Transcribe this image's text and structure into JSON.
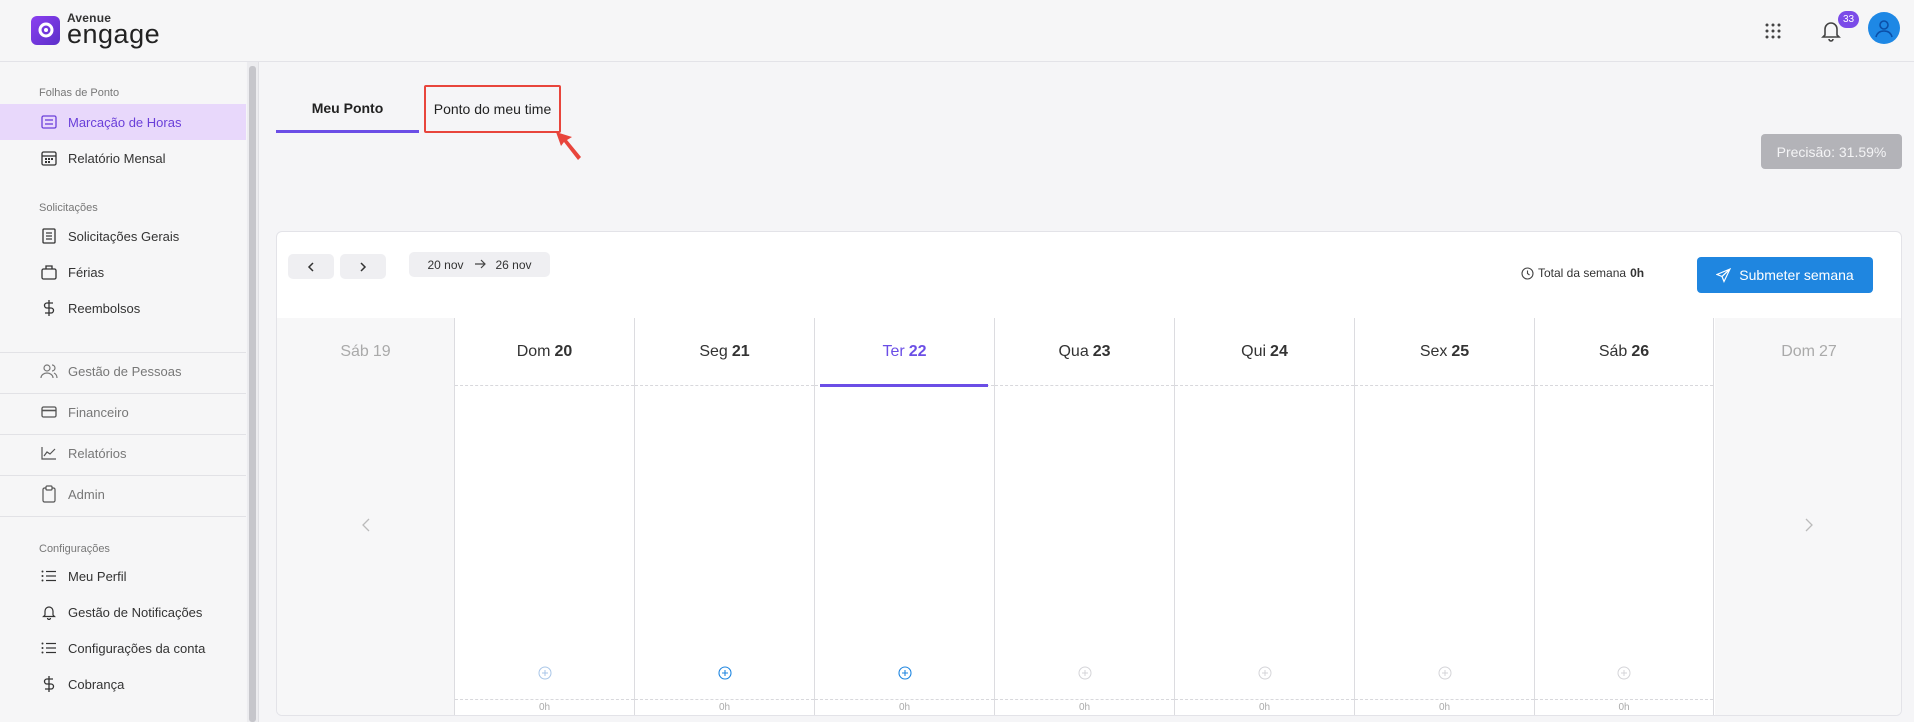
{
  "brand": {
    "small": "Avenue",
    "big": "engage"
  },
  "header": {
    "notifications_count": "33"
  },
  "sidebar": {
    "sections": [
      {
        "title": "Folhas de Ponto",
        "items": [
          {
            "label": "Marcação de Horas",
            "icon": "list-icon",
            "active": true
          },
          {
            "label": "Relatório Mensal",
            "icon": "calendar-icon"
          }
        ]
      },
      {
        "title": "Solicitações",
        "items": [
          {
            "label": "Solicitações Gerais",
            "icon": "form-icon"
          },
          {
            "label": "Férias",
            "icon": "suitcase-icon"
          },
          {
            "label": "Reembolsos",
            "icon": "dollar-icon"
          }
        ]
      },
      {
        "title": "",
        "items": [
          {
            "label": "Gestão de Pessoas",
            "icon": "people-icon"
          },
          {
            "label": "Financeiro",
            "icon": "card-icon"
          },
          {
            "label": "Relatórios",
            "icon": "chart-icon"
          },
          {
            "label": "Admin",
            "icon": "clipboard-icon"
          }
        ]
      },
      {
        "title": "Configurações",
        "items": [
          {
            "label": "Meu Perfil",
            "icon": "list-icon"
          },
          {
            "label": "Gestão de Notificações",
            "icon": "bell-icon"
          },
          {
            "label": "Configurações da conta",
            "icon": "list-icon"
          },
          {
            "label": "Cobrança",
            "icon": "dollar-icon"
          }
        ]
      }
    ]
  },
  "tabs": [
    {
      "label": "Meu Ponto"
    },
    {
      "label": "Ponto do meu time"
    }
  ],
  "precisao": "Precisão: 31.59%",
  "week": {
    "start": "20 nov",
    "end": "26 nov",
    "total_label": "Total da semana",
    "total_value": "0h",
    "submit_label": "Submeter semana"
  },
  "days": [
    {
      "name": "Sáb",
      "num": "19",
      "kind": "side"
    },
    {
      "name": "Dom",
      "num": "20",
      "kind": "day",
      "hours": "0h"
    },
    {
      "name": "Seg",
      "num": "21",
      "kind": "day",
      "hours": "0h"
    },
    {
      "name": "Ter",
      "num": "22",
      "kind": "today",
      "hours": "0h"
    },
    {
      "name": "Qua",
      "num": "23",
      "kind": "day",
      "hours": "0h"
    },
    {
      "name": "Qui",
      "num": "24",
      "kind": "day",
      "hours": "0h"
    },
    {
      "name": "Sex",
      "num": "25",
      "kind": "day",
      "hours": "0h"
    },
    {
      "name": "Sáb",
      "num": "26",
      "kind": "day",
      "hours": "0h"
    },
    {
      "name": "Dom",
      "num": "27",
      "kind": "side"
    }
  ],
  "colors": {
    "accent": "#6b4ee6",
    "primary": "#1f86e0",
    "highlight": "#e8453c"
  }
}
